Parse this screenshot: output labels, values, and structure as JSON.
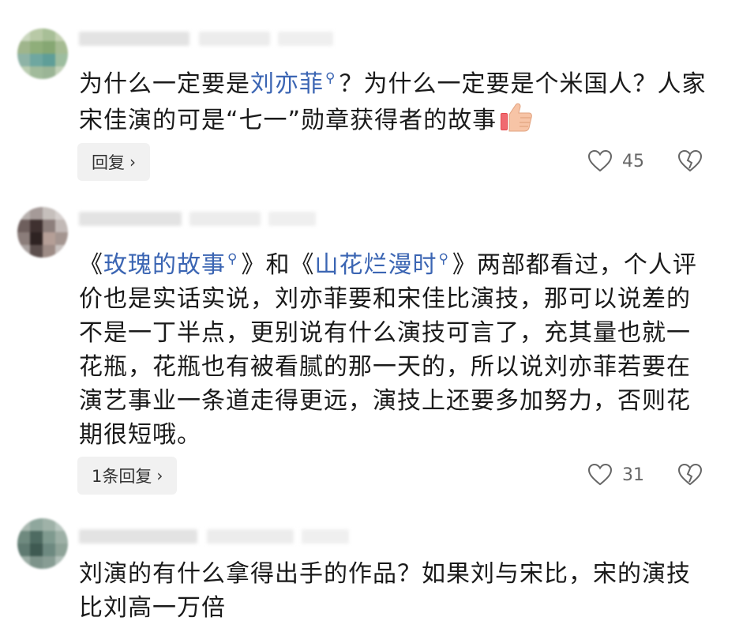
{
  "comments": [
    {
      "segments": [
        {
          "text": "为什么一定要是",
          "link": false
        },
        {
          "text": "刘亦菲",
          "link": true
        },
        {
          "text": "？为什么一定要是个米国人？人家宋佳演的可是“七一”勋章获得者的故事",
          "link": false
        }
      ],
      "reply_label": "回复",
      "likes": "45"
    },
    {
      "segments": [
        {
          "text": "《",
          "link": false
        },
        {
          "text": "玫瑰的故事",
          "link": true
        },
        {
          "text": "》和《",
          "link": false
        },
        {
          "text": "山花烂漫时",
          "link": true
        },
        {
          "text": "》两部都看过，个人评价也是实话实说，刘亦菲要和宋佳比演技，那可以说差的不是一丁半点，更别说有什么演技可言了，充其量也就一花瓶，花瓶也有被看腻的那一天的，所以说刘亦菲若要在演艺事业一条道走得更远，演技上还要多加努力，否则花期很短哦。",
          "link": false
        }
      ],
      "reply_label": "1条回复",
      "likes": "31"
    },
    {
      "segments": [
        {
          "text": "刘演的有什么拿得出手的作品？如果刘与宋比，宋的演技比刘高一万倍",
          "link": false
        }
      ]
    }
  ],
  "icons": {
    "search": "search-icon",
    "like": "heart-icon",
    "dislike": "broken-heart-icon",
    "thumbs_up": "thumbs-up-emoji",
    "chevron": "chevron-right-icon"
  },
  "colors": {
    "link": "#3b65b3",
    "reply_bg": "#f1f1f1"
  }
}
